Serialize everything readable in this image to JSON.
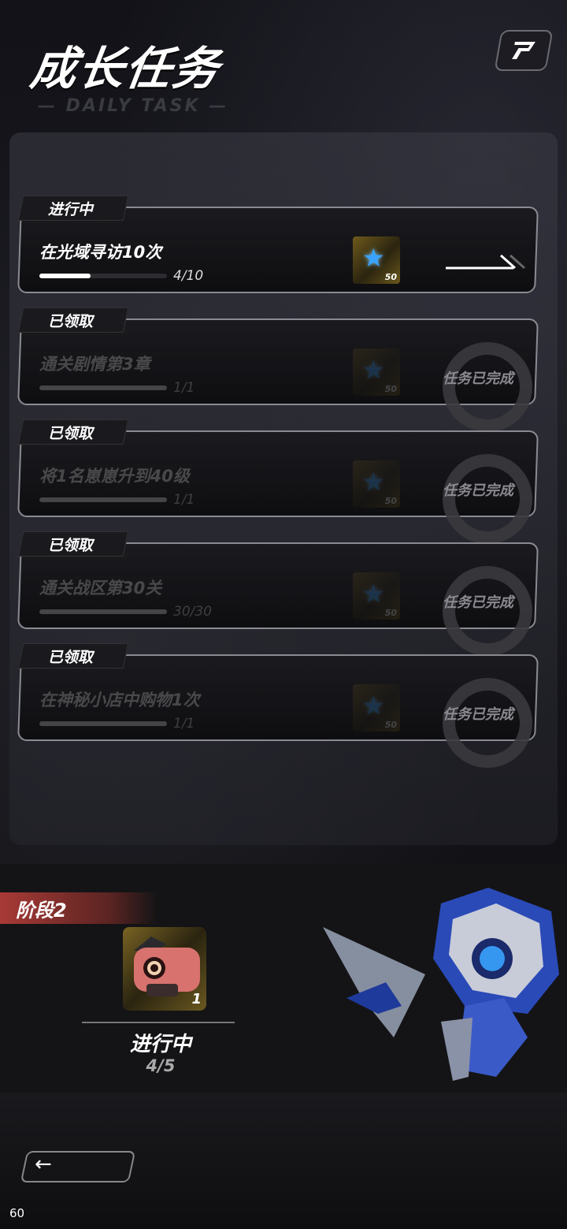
{
  "header": {
    "title": "成长任务",
    "subtitle": "— DAILY TASK —",
    "help_icon": "help-icon"
  },
  "tasks": [
    {
      "status": "进行中",
      "name": "在光域寻访10次",
      "progress": "4/10",
      "ratio": 0.4,
      "reward_qty": "50",
      "done": false
    },
    {
      "status": "已领取",
      "name": "通关剧情第3章",
      "progress": "1/1",
      "ratio": 1,
      "reward_qty": "50",
      "done": true,
      "done_label": "任务已完成"
    },
    {
      "status": "已领取",
      "name": "将1名崽崽升到40级",
      "progress": "1/1",
      "ratio": 1,
      "reward_qty": "50",
      "done": true,
      "done_label": "任务已完成"
    },
    {
      "status": "已领取",
      "name": "通关战区第30关",
      "progress": "30/30",
      "ratio": 1,
      "reward_qty": "50",
      "done": true,
      "done_label": "任务已完成"
    },
    {
      "status": "已领取",
      "name": "在神秘小店中购物1次",
      "progress": "1/1",
      "ratio": 1,
      "reward_qty": "50",
      "done": true,
      "done_label": "任务已完成"
    }
  ],
  "stage": {
    "label": "阶段2",
    "reward_qty": "1",
    "status": "进行中",
    "progress": "4/5"
  },
  "footer": {
    "back_icon": "←",
    "fps": "60"
  },
  "colors": {
    "accent_red": "#a83a36",
    "star_blue": "#3aa3ff",
    "gold": "#6e5a1c"
  }
}
